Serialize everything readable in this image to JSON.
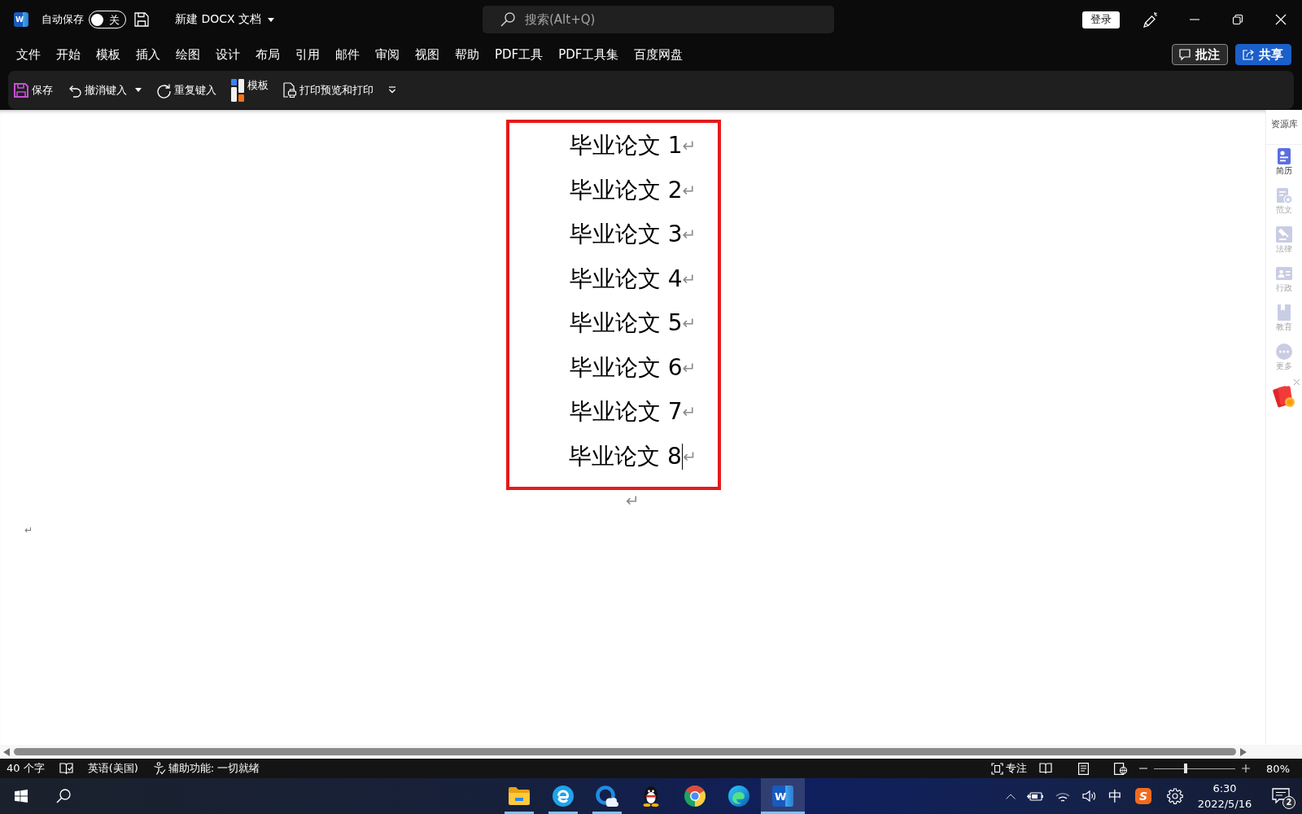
{
  "title_bar": {
    "logo": "W",
    "autosave_label": "自动保存",
    "autosave_toggle": {
      "on": false,
      "label": "关"
    },
    "document_title": "新建 DOCX 文档",
    "search": {
      "placeholder": "搜索(Alt+Q)"
    },
    "login_button": "登录"
  },
  "menu": {
    "items": [
      "文件",
      "开始",
      "模板",
      "插入",
      "绘图",
      "设计",
      "布局",
      "引用",
      "邮件",
      "审阅",
      "视图",
      "帮助",
      "PDF工具",
      "PDF工具集",
      "百度网盘"
    ],
    "comment_button": "批注",
    "share_button": "共享"
  },
  "quick_access": [
    {
      "kind": "save",
      "label": "保存"
    },
    {
      "kind": "undo",
      "label": "撤消键入"
    },
    {
      "kind": "redo",
      "label": "重复键入"
    },
    {
      "kind": "template",
      "label": "模板"
    },
    {
      "kind": "print",
      "label": "打印预览和打印"
    }
  ],
  "document": {
    "paragraphs": [
      {
        "text": "毕业论文 1",
        "mark": "↵",
        "caret": false
      },
      {
        "text": "毕业论文 2",
        "mark": "↵",
        "caret": false
      },
      {
        "text": "毕业论文 3",
        "mark": "↵",
        "caret": false
      },
      {
        "text": "毕业论文 4",
        "mark": "↵",
        "caret": false
      },
      {
        "text": "毕业论文 5",
        "mark": "↵",
        "caret": false
      },
      {
        "text": "毕业论文 6",
        "mark": "↵",
        "caret": false
      },
      {
        "text": "毕业论文 7",
        "mark": "↵",
        "caret": false
      },
      {
        "text": "毕业论文 8",
        "mark": "↵",
        "caret": true
      },
      {
        "mark": "↵",
        "caret": false
      }
    ],
    "stray_mark": "↵"
  },
  "resource_panel": {
    "title": "资源库",
    "items": [
      {
        "kind": "resume",
        "label": "简历",
        "selected": true
      },
      {
        "kind": "sample",
        "label": "范文",
        "selected": false
      },
      {
        "kind": "law",
        "label": "法律",
        "selected": false
      },
      {
        "kind": "admin",
        "label": "行政",
        "selected": false
      },
      {
        "kind": "education",
        "label": "教育",
        "selected": false
      },
      {
        "kind": "more",
        "label": "更多",
        "selected": false
      }
    ]
  },
  "status_bar": {
    "word_count": "40 个字",
    "language": "英语(美国)",
    "accessibility": "辅助功能: 一切就绪",
    "focus": "专注",
    "zoom": {
      "level": 0.39,
      "reading": "80%"
    }
  },
  "taskbar": {
    "apps": [
      {
        "kind": "folder",
        "running": true,
        "selected": false
      },
      {
        "kind": "e-browser",
        "running": true,
        "selected": false
      },
      {
        "kind": "cloud",
        "running": true,
        "selected": false
      },
      {
        "kind": "penguin",
        "running": false,
        "selected": false
      },
      {
        "kind": "ring-browser",
        "running": false,
        "selected": false
      },
      {
        "kind": "wave-browser",
        "running": false,
        "selected": false
      },
      {
        "kind": "word",
        "logo": "W",
        "running": true,
        "selected": true
      }
    ],
    "tray": {
      "ime": "中",
      "input_app_logo": "S",
      "time": "6:30",
      "date": "2022/5/16",
      "notifications": "2"
    }
  }
}
